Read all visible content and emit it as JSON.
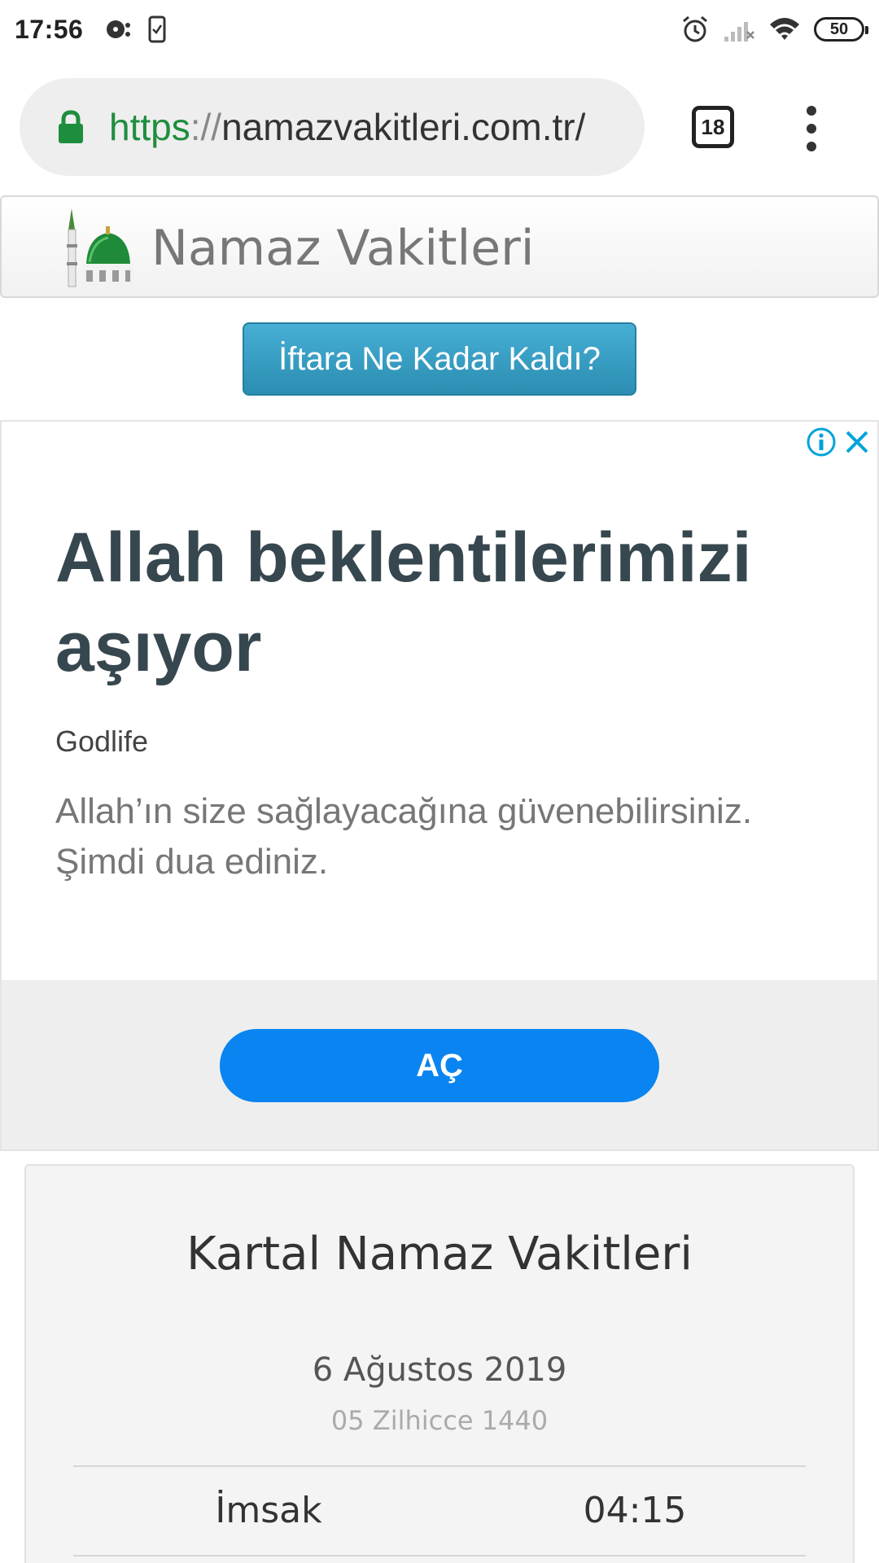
{
  "status_bar": {
    "time": "17:56",
    "battery": "50",
    "icons": [
      "media-icon",
      "phone-icon",
      "alarm-icon",
      "signal-icon",
      "wifi-icon",
      "battery-icon"
    ]
  },
  "browser": {
    "url_scheme": "https",
    "url_sep": "://",
    "url_host": "namazvakitleri.com.tr/",
    "tab_count": "18",
    "menu_icon": "more-vert-icon"
  },
  "site": {
    "title": "Namaz Vakitleri",
    "iftar_button": "İftara Ne Kadar Kaldı?"
  },
  "ad": {
    "headline": "Allah beklentilerimizi aşıyor",
    "advertiser": "Godlife",
    "description": "Allah’ın size sağlayacağına güvenebilirsiniz. Şimdi dua ediniz.",
    "cta": "AÇ",
    "colors": {
      "cta": "#0a84f0",
      "headline": "#37474f"
    }
  },
  "prayer_times": {
    "city_title": "Kartal Namaz Vakitleri",
    "gregorian_date": "6 Ağustos 2019",
    "hijri_date": "05 Zilhicce 1440",
    "rows": [
      {
        "name": "İmsak",
        "time": "04:15"
      }
    ]
  },
  "colors": {
    "url_scheme": "#1e8e3e",
    "iftar_button": "#2b8db2",
    "lock": "#1e8e3e"
  }
}
